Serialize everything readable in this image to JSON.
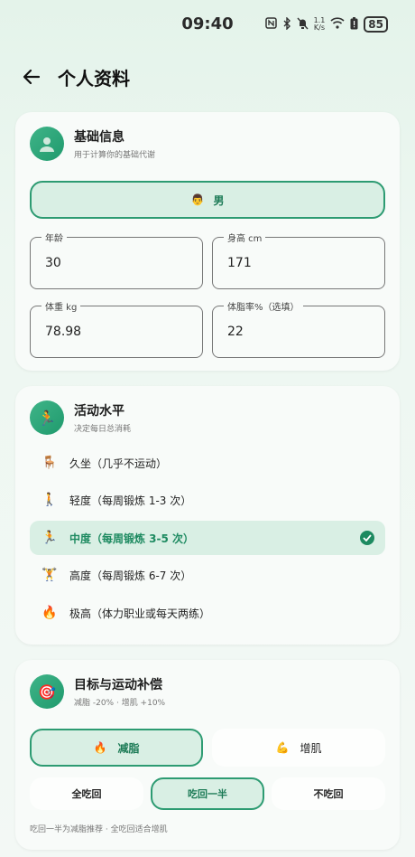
{
  "status": {
    "time": "09:40",
    "speed_value": "1.1",
    "speed_unit": "K/s",
    "battery": "85"
  },
  "header": {
    "title": "个人资料"
  },
  "basic": {
    "title": "基础信息",
    "subtitle": "用于计算你的基础代谢",
    "avatar_icon": "person-icon",
    "gender_emoji": "👨",
    "gender_label": "男",
    "age": {
      "label": "年龄",
      "value": "30"
    },
    "height": {
      "label": "身高 cm",
      "value": "171"
    },
    "weight": {
      "label": "体重 kg",
      "value": "78.98"
    },
    "bodyfat": {
      "label": "体脂率%（选填）",
      "value": "22"
    }
  },
  "activity": {
    "title": "活动水平",
    "subtitle": "决定每日总消耗",
    "icon": "🏃",
    "items": [
      {
        "emoji": "🪑",
        "label": "久坐（几乎不运动）"
      },
      {
        "emoji": "🚶",
        "label": "轻度（每周锻炼 1-3 次）"
      },
      {
        "emoji": "🏃",
        "label": "中度（每周锻炼 3-5 次）"
      },
      {
        "emoji": "🏋",
        "label": "高度（每周锻炼 6-7 次）"
      },
      {
        "emoji": "🔥",
        "label": "极高（体力职业或每天两练）"
      }
    ],
    "selected_index": 2
  },
  "goal": {
    "title": "目标与运动补偿",
    "subtitle": "减脂 -20% · 增肌 +10%",
    "icon": "🎯",
    "options": [
      {
        "emoji": "🔥",
        "label": "减脂"
      },
      {
        "emoji": "💪",
        "label": "增肌"
      }
    ],
    "eat_options": [
      "全吃回",
      "吃回一半",
      "不吃回"
    ],
    "note": "吃回一半为减脂推荐 · 全吃回适合增肌"
  },
  "colors": {
    "accent": "#1d8a60",
    "accent_bg": "#d9efe4"
  }
}
